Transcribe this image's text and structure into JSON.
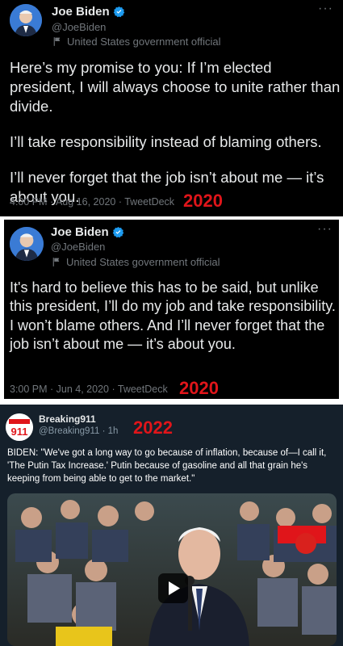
{
  "tweets": [
    {
      "author_name": "Joe Biden",
      "handle": "@JoeBiden",
      "label": "United States government official",
      "body": [
        "Here’s my promise to you: If I’m elected president, I will always choose to unite rather than divide.",
        "I’ll take responsibility instead of blaming others.",
        "I’ll never forget that the job isn’t about me — it’s about you."
      ],
      "meta": "4:00 PM · Aug 16, 2020 · TweetDeck",
      "year_annotation": "2020",
      "more_icon": "more-icon"
    },
    {
      "author_name": "Joe Biden",
      "handle": "@JoeBiden",
      "label": "United States government official",
      "body": [
        "It's hard to believe this has to be said, but unlike this president, I’ll do my job and take responsibility. I won’t blame others. And I’ll never forget that the job isn’t about me — it’s about you."
      ],
      "meta": "3:00 PM · Jun 4, 2020 · TweetDeck",
      "year_annotation": "2020",
      "more_icon": "more-icon"
    },
    {
      "author_name": "Breaking911",
      "handle": "@Breaking911 · 1h",
      "avatar_text": "911",
      "body": [
        "BIDEN: \"We've got a long way to go because of inflation, because of—I call it, 'The Putin Tax Increase.' Putin because of gasoline and all that grain he's keeping from being able to get to the market.\""
      ],
      "year_annotation": "2022"
    }
  ],
  "colors": {
    "annotation_red": "#e0151a",
    "tweet_bg": "#000000",
    "dim_tweet_bg": "#15202b",
    "verified_blue": "#1d9bf0",
    "secondary_text": "#71767b"
  }
}
